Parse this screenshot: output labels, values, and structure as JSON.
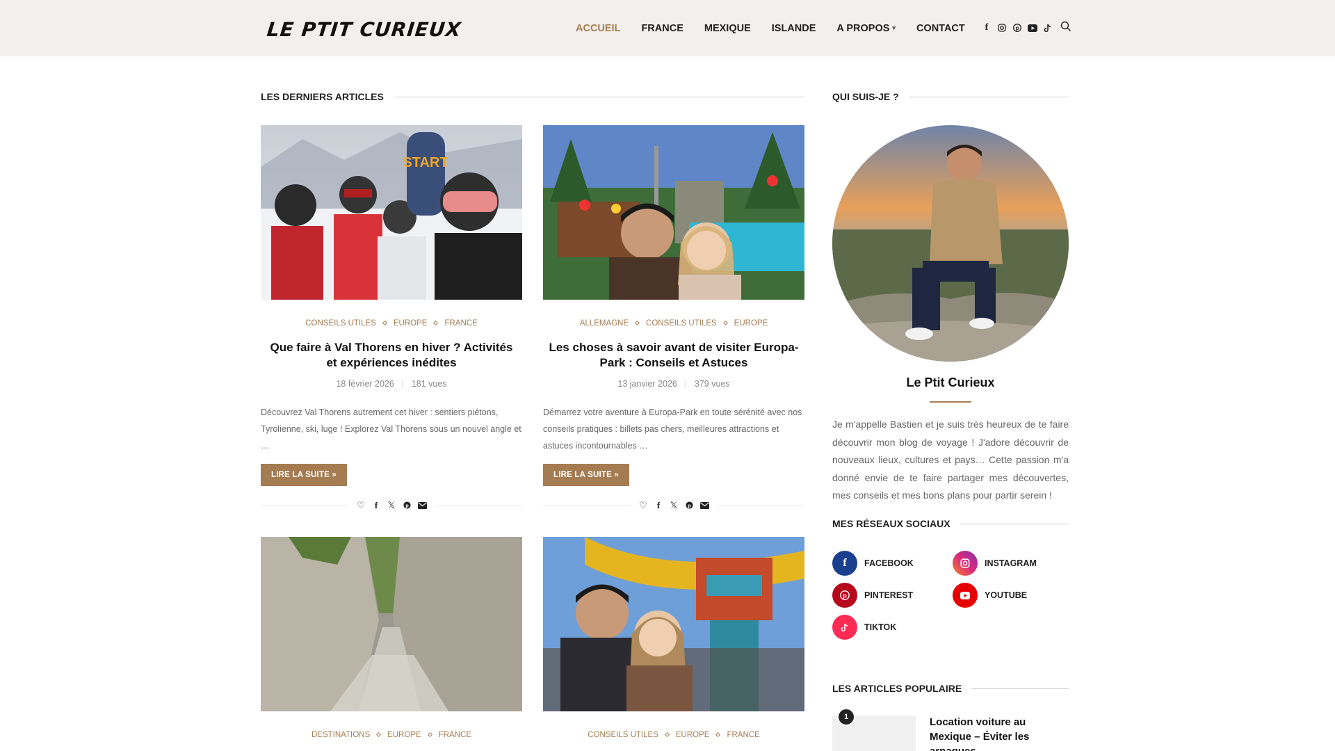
{
  "header": {
    "logo": "LE PTIT CURIEUX",
    "nav": [
      {
        "label": "ACCUEIL",
        "active": true
      },
      {
        "label": "FRANCE",
        "active": false
      },
      {
        "label": "MEXIQUE",
        "active": false
      },
      {
        "label": "ISLANDE",
        "active": false
      },
      {
        "label": "A PROPOS",
        "active": false,
        "dropdown": true
      },
      {
        "label": "CONTACT",
        "active": false
      }
    ],
    "social_icons": [
      "facebook-icon",
      "instagram-icon",
      "pinterest-icon",
      "youtube-icon",
      "tiktok-icon"
    ],
    "search_icon": "search-icon"
  },
  "main": {
    "section_title": "LES DERNIERS ARTICLES",
    "articles": [
      {
        "categories": [
          "CONSEILS UTILES",
          "EUROPE",
          "FRANCE"
        ],
        "title": "Que faire à Val Thorens en hiver ? Activités et expériences inédites",
        "date": "18 février 2026",
        "views": "181 vues",
        "excerpt": "Découvrez Val Thorens autrement cet hiver : sentiers piétons, Tyrolienne, ski, luge ! Explorez Val Thorens sous un nouvel angle et …",
        "readmore": "LIRE LA SUITE »"
      },
      {
        "categories": [
          "ALLEMAGNE",
          "CONSEILS UTILES",
          "EUROPE"
        ],
        "title": "Les choses à savoir avant de visiter Europa-Park : Conseils et Astuces",
        "date": "13 janvier 2026",
        "views": "379 vues",
        "excerpt": "Démarrez votre aventure à Europa-Park en toute sérénité avec nos conseils pratiques : billets pas chers, meilleures attractions et astuces incontournables …",
        "readmore": "LIRE LA SUITE »"
      },
      {
        "categories": [
          "DESTINATIONS",
          "EUROPE",
          "FRANCE"
        ]
      },
      {
        "categories": [
          "CONSEILS UTILES",
          "EUROPE",
          "FRANCE"
        ]
      }
    ]
  },
  "sidebar": {
    "about_title": "QUI SUIS-JE ?",
    "about_name": "Le Ptit Curieux",
    "about_text": "Je m'appelle Bastien et je suis très heureux de te faire découvrir mon blog de voyage ! J'adore découvrir de nouveaux lieux, cultures et pays… Cette passion m'a donné envie de te faire partager mes découvertes, mes conseils et mes bons plans pour partir serein !",
    "socials_title": "MES RÉSEAUX SOCIAUX",
    "socials": [
      {
        "label": "FACEBOOK",
        "color": "#1a3f8f"
      },
      {
        "label": "INSTAGRAM",
        "color": "#c13584"
      },
      {
        "label": "PINTEREST",
        "color": "#b7081b"
      },
      {
        "label": "YOUTUBE",
        "color": "#e60000"
      },
      {
        "label": "TIKTOK",
        "color": "#fe2c55"
      }
    ],
    "popular_title": "LES ARTICLES POPULAIRE",
    "popular": [
      {
        "rank": "1",
        "title": "Location voiture au Mexique – Éviter les arnaques"
      }
    ]
  },
  "colors": {
    "accent": "#a57c52",
    "header_bg": "#f3efec"
  }
}
